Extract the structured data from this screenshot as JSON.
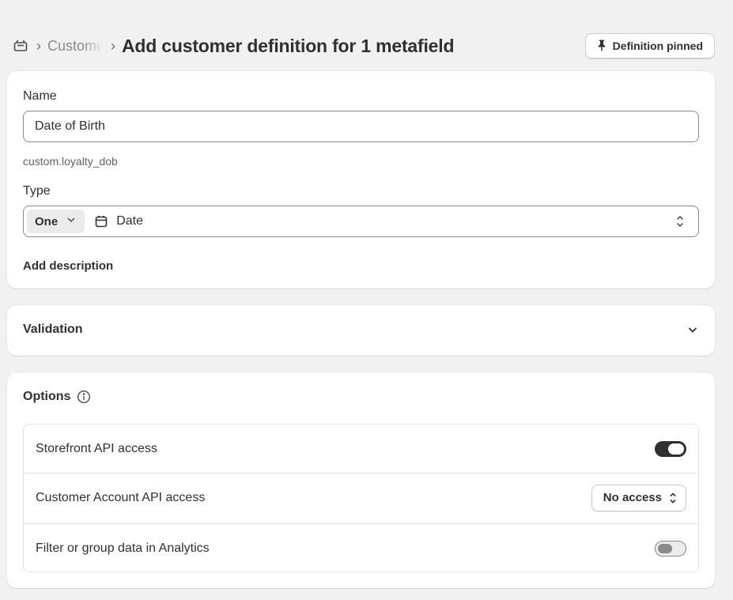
{
  "header": {
    "breadcrumb_icon": "customer-store-icon",
    "breadcrumb_separator": "›",
    "breadcrumb_link": "Customers",
    "title": "Add customer definition for 1 metafield",
    "pin_button": {
      "icon": "pin-icon",
      "label": "Definition pinned"
    }
  },
  "definition": {
    "name_label": "Name",
    "name_value": "Date of Birth",
    "namespace_key": "custom.loyalty_dob",
    "type_label": "Type",
    "type_quantity": "One",
    "type_icon": "calendar-icon",
    "type_value": "Date",
    "add_description": "Add description"
  },
  "validation": {
    "title": "Validation"
  },
  "options": {
    "title": "Options",
    "rows": [
      {
        "label": "Storefront API access",
        "control": "toggle",
        "on": true
      },
      {
        "label": "Customer Account API access",
        "control": "select",
        "value": "No access"
      },
      {
        "label": "Filter or group data in Analytics",
        "control": "toggle",
        "on": false
      }
    ]
  },
  "colors": {
    "background": "#f1f1f1",
    "card": "#ffffff",
    "text": "#303030",
    "toggle_on": "#303030"
  }
}
